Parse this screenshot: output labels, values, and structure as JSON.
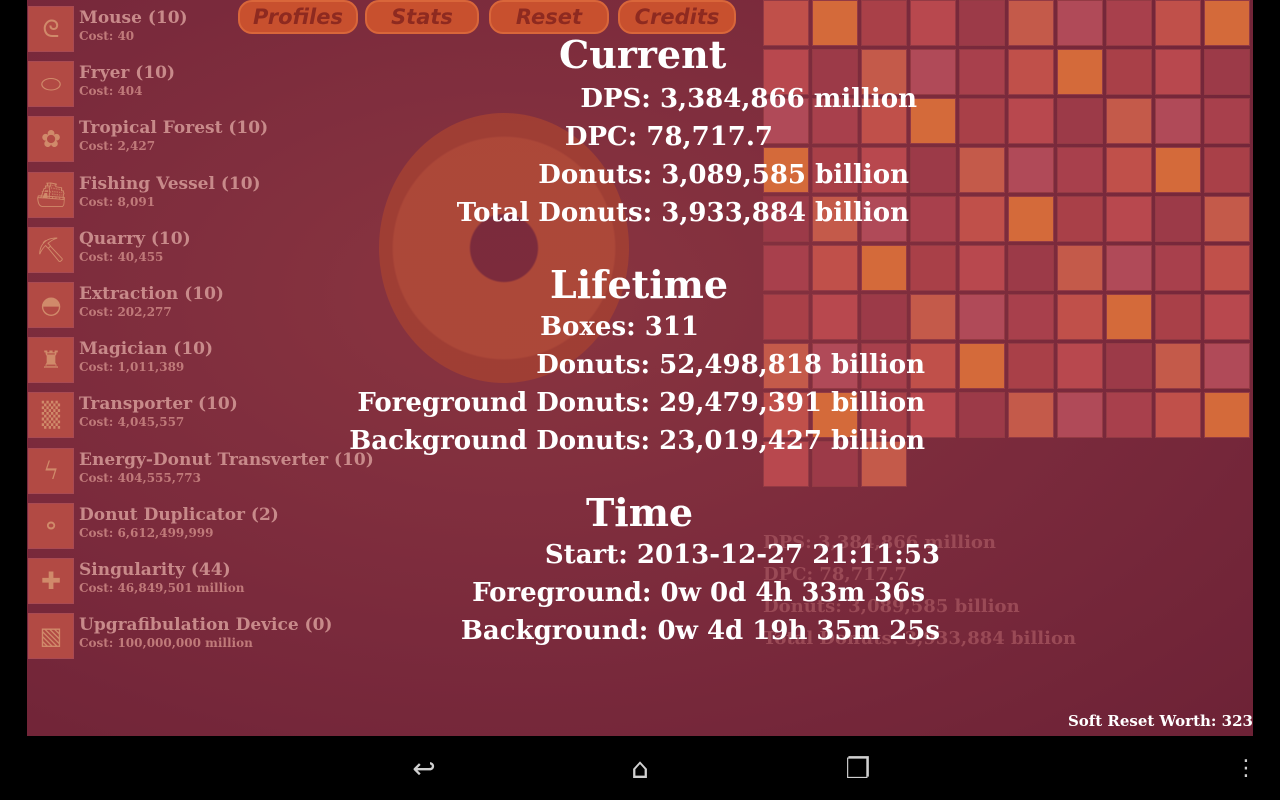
{
  "top_buttons": [
    "Profiles",
    "Stats",
    "Reset",
    "Credits"
  ],
  "store": [
    {
      "name": "Mouse (10)",
      "cost": "Cost: 40",
      "icon": "mouse-icon",
      "glyph": "ᘓ"
    },
    {
      "name": "Fryer (10)",
      "cost": "Cost: 404",
      "icon": "fryer-icon",
      "glyph": "⬭"
    },
    {
      "name": "Tropical Forest (10)",
      "cost": "Cost: 2,427",
      "icon": "forest-icon",
      "glyph": "✿"
    },
    {
      "name": "Fishing Vessel (10)",
      "cost": "Cost: 8,091",
      "icon": "vessel-icon",
      "glyph": "⛴"
    },
    {
      "name": "Quarry (10)",
      "cost": "Cost: 40,455",
      "icon": "pickaxe-icon",
      "glyph": "⛏"
    },
    {
      "name": "Extraction (10)",
      "cost": "Cost: 202,277",
      "icon": "extraction-icon",
      "glyph": "◓"
    },
    {
      "name": "Magician (10)",
      "cost": "Cost: 1,011,389",
      "icon": "magician-hat-icon",
      "glyph": "♜"
    },
    {
      "name": "Transporter (10)",
      "cost": "Cost: 4,045,557",
      "icon": "transporter-icon",
      "glyph": "▒"
    },
    {
      "name": "Energy-Donut Transverter (10)",
      "cost": "Cost: 404,555,773",
      "icon": "energy-icon",
      "glyph": "ϟ"
    },
    {
      "name": "Donut Duplicator (2)",
      "cost": "Cost: 6,612,499,999",
      "icon": "duplicator-icon",
      "glyph": "⚬"
    },
    {
      "name": "Singularity (44)",
      "cost": "Cost: 46,849,501 million",
      "icon": "singularity-icon",
      "glyph": "✚"
    },
    {
      "name": "Upgrafibulation Device (0)",
      "cost": "Cost: 100,000,000 million",
      "icon": "upgrafibulation-icon",
      "glyph": "▧"
    }
  ],
  "stats": {
    "current_title": "Current",
    "dps": "DPS: 3,384,866 million",
    "dpc": "DPC: 78,717.7",
    "donuts": "Donuts: 3,089,585 billion",
    "total_donuts": "Total Donuts: 3,933,884 billion",
    "lifetime_title": "Lifetime",
    "boxes": "Boxes: 311",
    "lifetime_donuts": "Donuts: 52,498,818 billion",
    "foreground_donuts": "Foreground Donuts: 29,479,391 billion",
    "background_donuts": "Background Donuts: 23,019,427 billion",
    "time_title": "Time",
    "start": "Start: 2013-12-27 21:11:53",
    "foreground_time": "Foreground: 0w 0d 4h 33m 36s",
    "background_time": "Background: 0w 4d 19h 35m 25s"
  },
  "ghost_stats": [
    "DPS: 3,384,866 million",
    "DPC: 78,717.7",
    "Donuts: 3,089,585 billion",
    "Total Donuts: 3,933,884 billion"
  ],
  "soft_reset": "Soft Reset Worth: 323",
  "colors": {
    "background": "#7a2a3c",
    "button": "#c8502e",
    "text": "#ffffff"
  }
}
